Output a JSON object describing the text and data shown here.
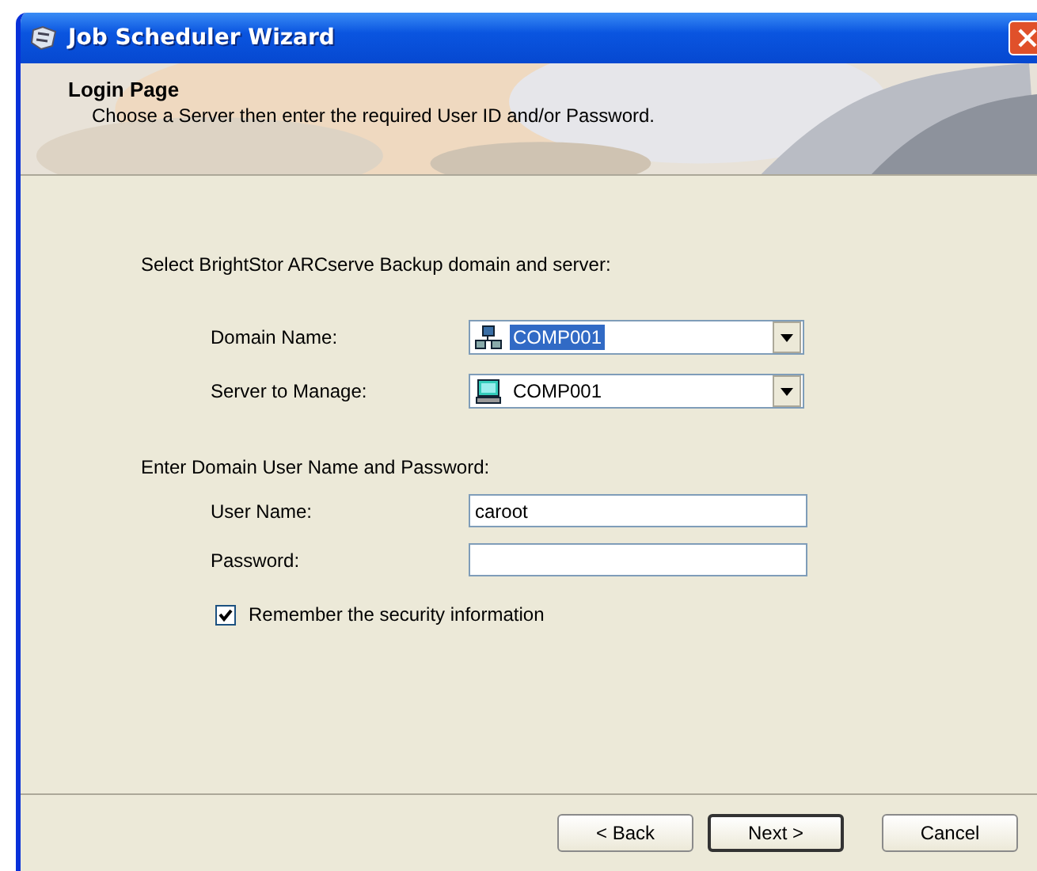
{
  "window": {
    "title": "Job Scheduler Wizard"
  },
  "header": {
    "title": "Login Page",
    "subtitle": "Choose a Server then enter the required User ID and/or Password."
  },
  "domain_section": {
    "label": "Select BrightStor ARCserve Backup domain and server:",
    "fields": [
      {
        "label": "Domain Name:",
        "value": "COMP001",
        "kind": "domain",
        "selected": true
      },
      {
        "label": "Server to Manage:",
        "value": "COMP001",
        "kind": "server",
        "selected": false
      }
    ]
  },
  "login_section": {
    "label": "Enter Domain User Name and Password:",
    "fields": [
      {
        "label": "User Name:",
        "value": "caroot"
      },
      {
        "label": "Password:"
      }
    ],
    "remember": {
      "label": "Remember the security information",
      "checked": true
    }
  },
  "buttons": [
    {
      "label": "< Back",
      "default": false
    },
    {
      "label": "Next >",
      "default": true
    },
    {
      "label": "Cancel",
      "default": false
    }
  ]
}
